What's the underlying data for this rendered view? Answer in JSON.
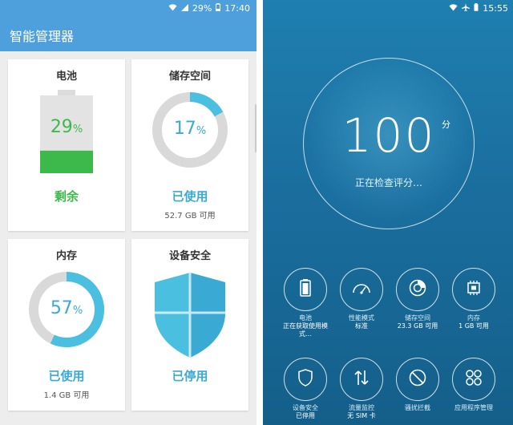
{
  "left": {
    "status": {
      "signal_text": "29%",
      "time": "17:40"
    },
    "app_title": "智能管理器",
    "battery": {
      "title": "电池",
      "percent": "29",
      "percent_unit": "%",
      "level": 0.29,
      "status": "剩余",
      "color": "#3db94b"
    },
    "storage": {
      "title": "储存空间",
      "percent": "17",
      "percent_unit": "%",
      "level": 0.17,
      "status": "已使用",
      "sub": "52.7 GB 可用",
      "color": "#4bbfe0"
    },
    "memory": {
      "title": "内存",
      "percent": "57",
      "percent_unit": "%",
      "level": 0.57,
      "status": "已使用",
      "sub": "1.4 GB 可用",
      "color": "#4bbfe0"
    },
    "security": {
      "title": "设备安全",
      "status": "已停用",
      "icon": "shield-icon",
      "color": "#4bbfe0"
    }
  },
  "right": {
    "status": {
      "time": "15:55"
    },
    "score": "100",
    "score_unit": "分",
    "checking": "正在检查评分…",
    "tiles": [
      {
        "icon": "battery-icon",
        "label": "电池",
        "value": "正在获取使用模式…"
      },
      {
        "icon": "gauge-icon",
        "label": "性能模式",
        "value": "标准"
      },
      {
        "icon": "storage-icon",
        "label": "储存空间",
        "value": "23.3 GB 可用"
      },
      {
        "icon": "memory-chip-icon",
        "label": "内存",
        "value": "1 GB 可用"
      },
      {
        "icon": "shield-icon",
        "label": "设备安全",
        "value": "已停用"
      },
      {
        "icon": "data-transfer-icon",
        "label": "流量监控",
        "value": "无 SIM 卡"
      },
      {
        "icon": "block-icon",
        "label": "骚扰拦截",
        "value": ""
      },
      {
        "icon": "app-grid-icon",
        "label": "应用程序管理",
        "value": ""
      }
    ]
  }
}
